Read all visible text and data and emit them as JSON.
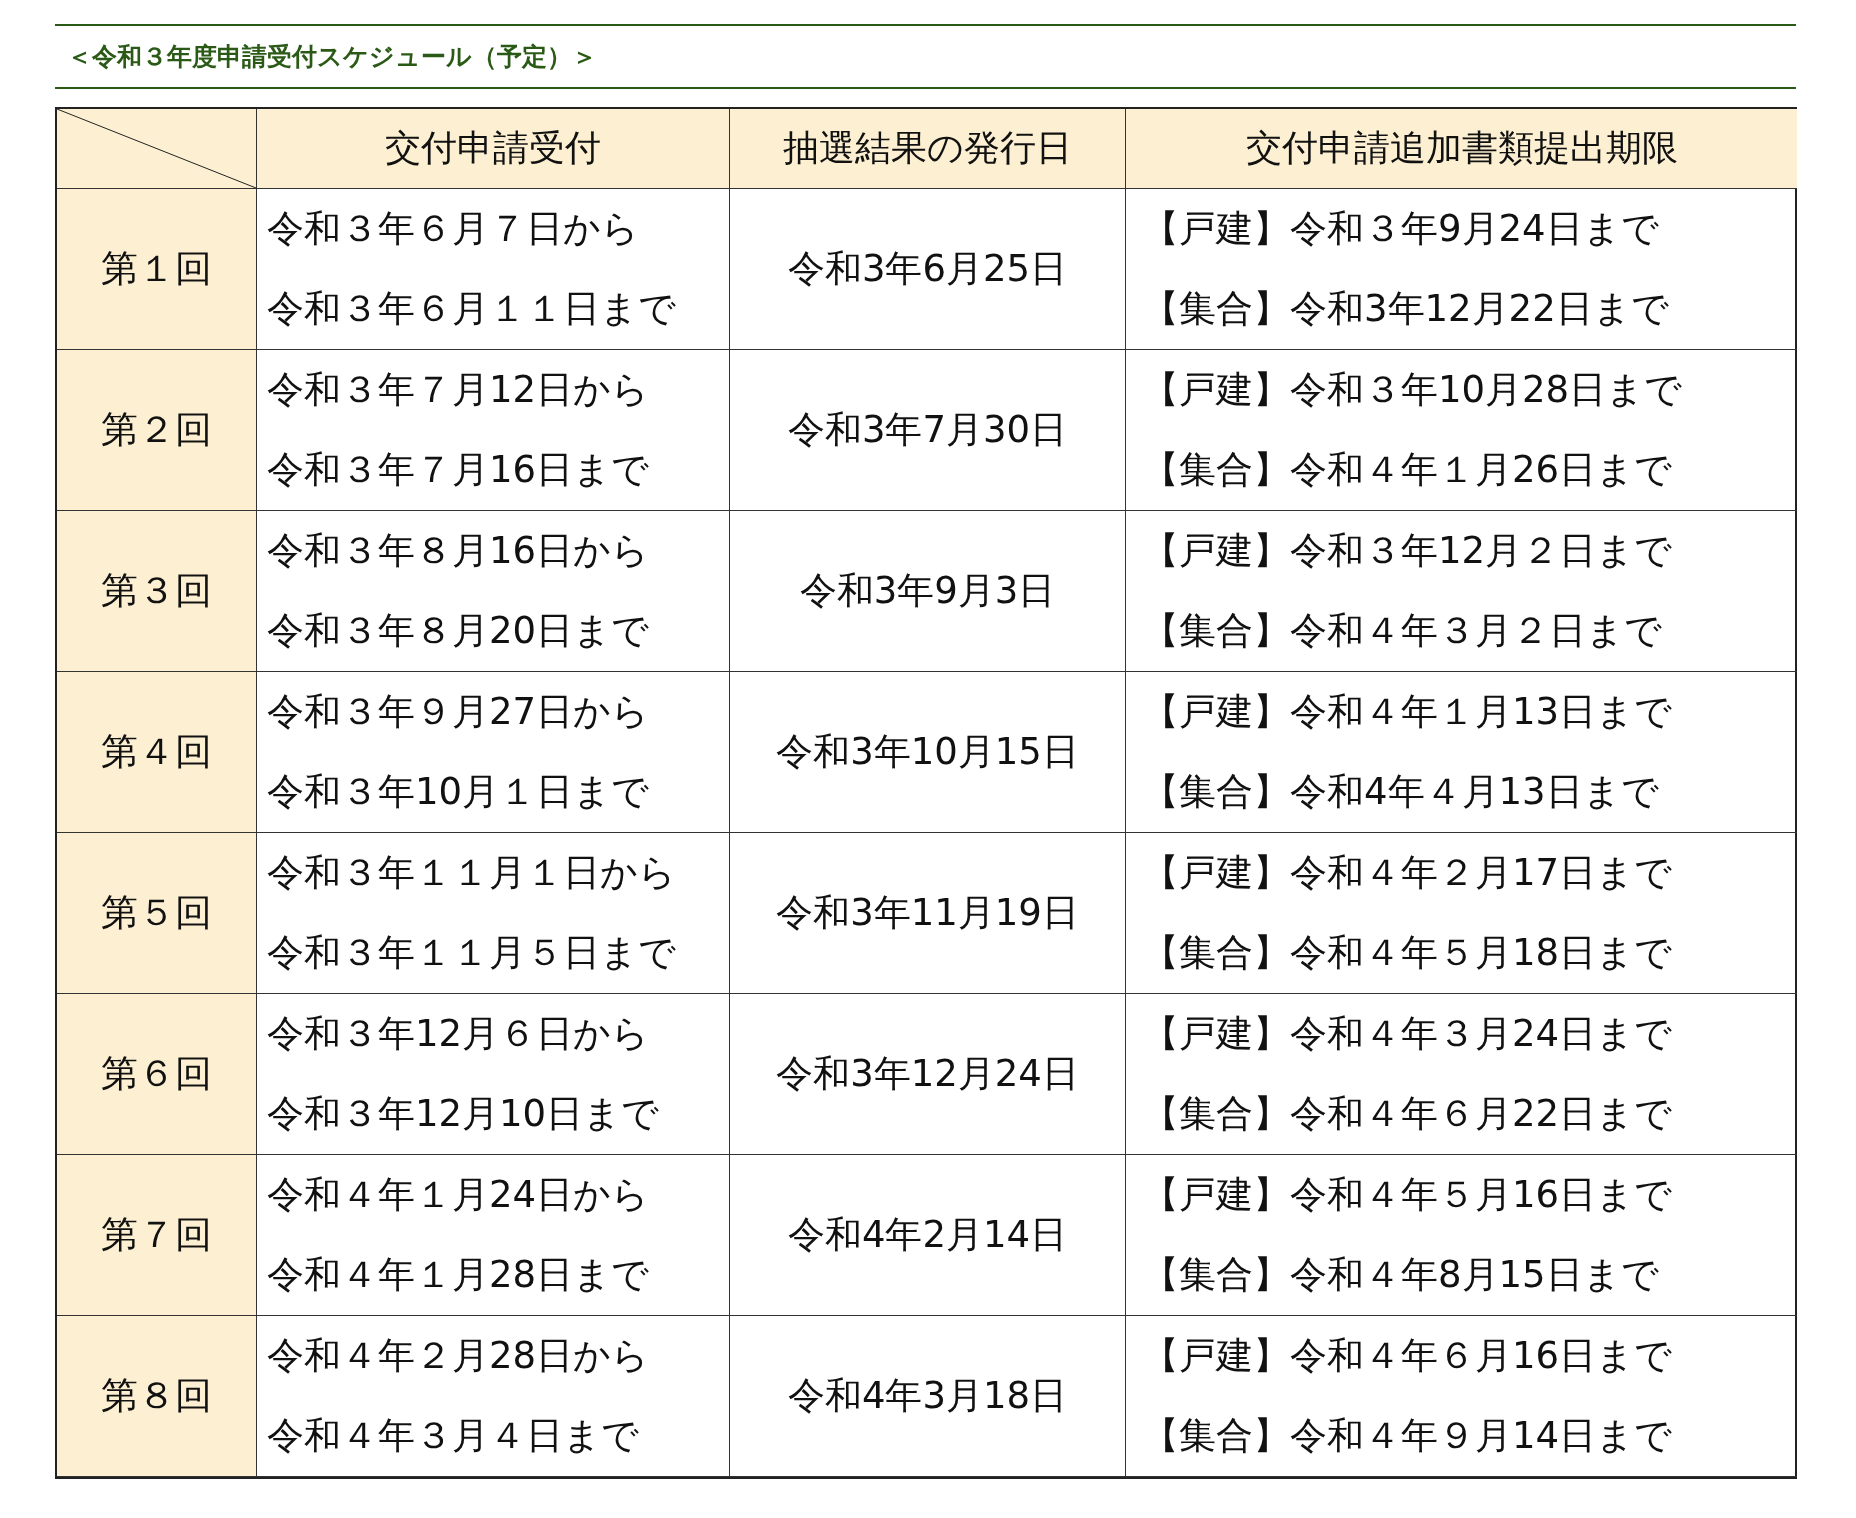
{
  "title": "＜令和３年度申請受付スケジュール（予定）＞",
  "table": {
    "columns": [
      "交付申請受付",
      "抽選結果の発行日",
      "交付申請追加書類提出期限"
    ],
    "rows": [
      {
        "round": "第１回",
        "application": [
          "令和３年６月７日から",
          "令和３年６月１１日まで"
        ],
        "lottery_date": "令和3年6月25日",
        "deadlines": [
          "【戸建】令和３年9月24日まで",
          "【集合】令和3年12月22日まで"
        ]
      },
      {
        "round": "第２回",
        "application": [
          "令和３年７月12日から",
          "令和３年７月16日まで"
        ],
        "lottery_date": "令和3年7月30日",
        "deadlines": [
          "【戸建】令和３年10月28日まで",
          "【集合】令和４年１月26日まで"
        ]
      },
      {
        "round": "第３回",
        "application": [
          "令和３年８月16日から",
          "令和３年８月20日まで"
        ],
        "lottery_date": "令和3年9月3日",
        "deadlines": [
          "【戸建】令和３年12月２日まで",
          "【集合】令和４年３月２日まで"
        ]
      },
      {
        "round": "第４回",
        "application": [
          "令和３年９月27日から",
          "令和３年10月１日まで"
        ],
        "lottery_date": "令和3年10月15日",
        "deadlines": [
          "【戸建】令和４年１月13日まで",
          "【集合】令和4年４月13日まで"
        ]
      },
      {
        "round": "第５回",
        "application": [
          "令和３年１１月１日から",
          "令和３年１１月５日まで"
        ],
        "lottery_date": "令和3年11月19日",
        "deadlines": [
          "【戸建】令和４年２月17日まで",
          "【集合】令和４年５月18日まで"
        ]
      },
      {
        "round": "第６回",
        "application": [
          "令和３年12月６日から",
          "令和３年12月10日まで"
        ],
        "lottery_date": "令和3年12月24日",
        "deadlines": [
          "【戸建】令和４年３月24日まで",
          "【集合】令和４年６月22日まで"
        ]
      },
      {
        "round": "第７回",
        "application": [
          "令和４年１月24日から",
          "令和４年１月28日まで"
        ],
        "lottery_date": "令和4年2月14日",
        "deadlines": [
          "【戸建】令和４年５月16日まで",
          "【集合】令和４年8月15日まで"
        ]
      },
      {
        "round": "第８回",
        "application": [
          "令和４年２月28日から",
          "令和４年３月４日まで"
        ],
        "lottery_date": "令和4年3月18日",
        "deadlines": [
          "【戸建】令和４年６月16日まで",
          "【集合】令和４年９月14日まで"
        ]
      }
    ]
  }
}
